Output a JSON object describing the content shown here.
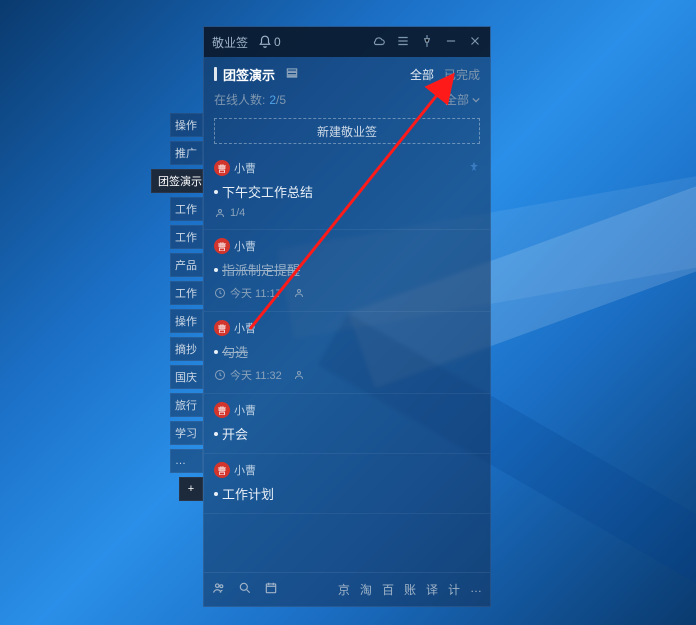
{
  "titlebar": {
    "app_name": "敬业签",
    "bell_count": "0"
  },
  "header": {
    "title": "团签演示",
    "filter_all": "全部",
    "filter_done": "已完成"
  },
  "online": {
    "label": "在线人数:",
    "current": "2",
    "sep": "/",
    "total": "5",
    "right_label": "全部"
  },
  "newbtn": {
    "label": "新建敬业签"
  },
  "items": [
    {
      "author": "小曹",
      "content": "下午交工作总结",
      "pinned": true,
      "strike": false,
      "meta_type": "people",
      "meta_text": "1/4"
    },
    {
      "author": "小曹",
      "content": "指派制定提醒",
      "pinned": false,
      "strike": true,
      "meta_type": "time",
      "meta_text": "今天 11:17",
      "meta_extra": true
    },
    {
      "author": "小曹",
      "content": "勾选",
      "pinned": false,
      "strike": true,
      "meta_type": "time",
      "meta_text": "今天 11:32",
      "meta_extra": true
    },
    {
      "author": "小曹",
      "content": "开会",
      "pinned": false,
      "strike": false
    },
    {
      "author": "小曹",
      "content": "工作计划",
      "pinned": false,
      "strike": false
    }
  ],
  "footer": {
    "right": [
      "京",
      "淘",
      "百",
      "账",
      "译",
      "计",
      "…"
    ]
  },
  "sidetabs": [
    "操作",
    "推广",
    "团签演示",
    "工作",
    "工作",
    "产品",
    "工作",
    "操作",
    "摘抄",
    "国庆",
    "旅行",
    "学习",
    "…"
  ],
  "active_tab_index": 2,
  "avatar_text": "曹"
}
